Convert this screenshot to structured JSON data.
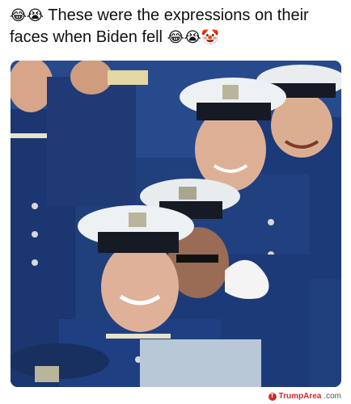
{
  "post": {
    "caption_prefix_emoji": "😂😭",
    "caption_text": "These were the expressions on their faces when Biden fell",
    "caption_suffix_emoji": "😂😭🤡"
  },
  "photo": {
    "subject": "cadets-in-white-caps-laughing"
  },
  "watermark": {
    "name": "TrumpArea",
    "suffix": ".com"
  },
  "colors": {
    "uniform_blue": "#1d3c78",
    "cap_white": "#e9edf0",
    "visor_black": "#151a24",
    "skin": "#d9a98a",
    "brand_red": "#d42a2a"
  }
}
